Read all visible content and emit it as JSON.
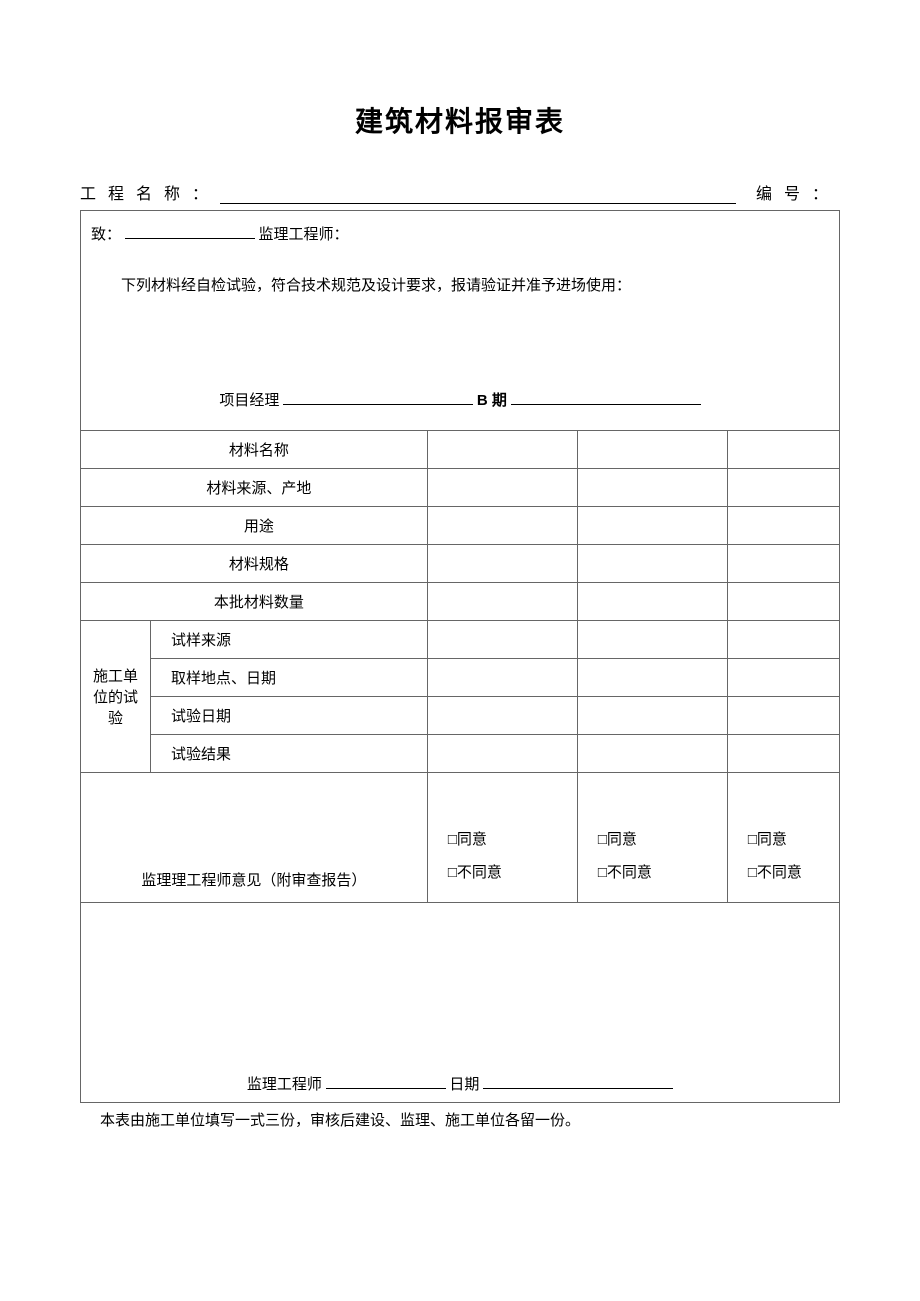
{
  "title": "建筑材料报审表",
  "header": {
    "project_label": "工程名称：",
    "serial_label": "编号："
  },
  "intro": {
    "to_prefix": "致：",
    "to_suffix": "监理工程师：",
    "body": "下列材料经自检试验，符合技术规范及设计要求，报请验证并准予进场使用：",
    "pm_label": "项目经理",
    "date_label": "B 期"
  },
  "rows": {
    "material_name": "材料名称",
    "material_source": "材料来源、产地",
    "usage": "用途",
    "spec": "材料规格",
    "quantity": "本批材料数量",
    "group_label": "施工单位的试验",
    "sample_source": "试样来源",
    "sample_loc_date": "取样地点、日期",
    "test_date": "试验日期",
    "test_result": "试验结果"
  },
  "opinion": {
    "label": "监理理工程师意见（附审查报告）",
    "agree": "□同意",
    "disagree": "□不同意"
  },
  "footer": {
    "engineer_label": "监理工程师",
    "date_label": "日期"
  },
  "note": "本表由施工单位填写一式三份，审核后建设、监理、施工单位各留一份。"
}
